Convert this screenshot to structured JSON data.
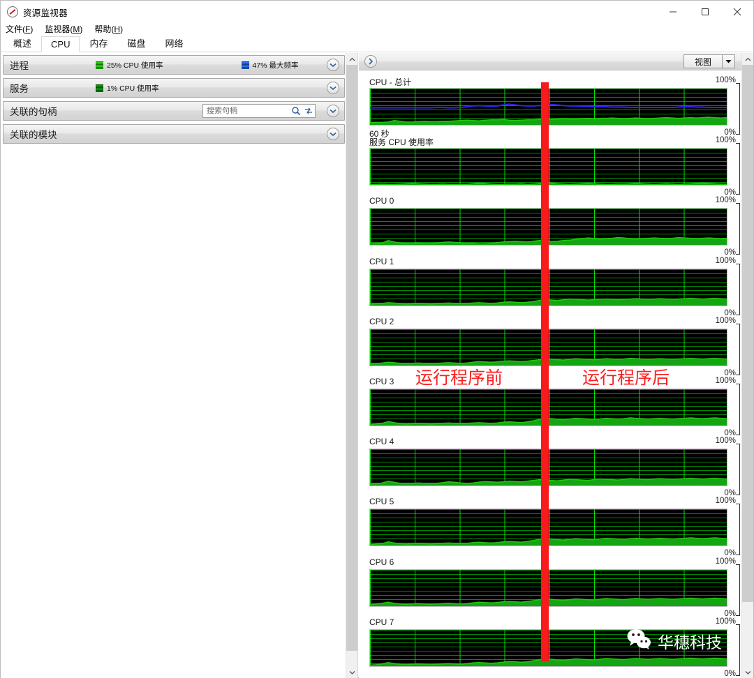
{
  "window": {
    "title": "资源监视器",
    "icon": "gauge-icon",
    "controls": {
      "minimize": "—",
      "maximize": "▢",
      "close": "✕"
    }
  },
  "menu": [
    {
      "label": "文件",
      "accel": "F"
    },
    {
      "label": "监视器",
      "accel": "M"
    },
    {
      "label": "帮助",
      "accel": "H"
    }
  ],
  "tabs": [
    {
      "label": "概述",
      "active": false
    },
    {
      "label": "CPU",
      "active": true
    },
    {
      "label": "内存",
      "active": false
    },
    {
      "label": "磁盘",
      "active": false
    },
    {
      "label": "网络",
      "active": false
    }
  ],
  "left_panels": [
    {
      "title": "进程",
      "stats": [
        {
          "color": "#35d21a",
          "label": "25% CPU 使用率"
        },
        {
          "color": "#2f6ff0",
          "label": "47% 最大频率"
        }
      ],
      "has_search": false
    },
    {
      "title": "服务",
      "stats": [
        {
          "color": "#0f9a0f",
          "label": "1% CPU 使用率"
        }
      ],
      "has_search": false
    },
    {
      "title": "关联的句柄",
      "stats": [],
      "has_search": true,
      "search_placeholder": "搜索句柄",
      "search_value": ""
    },
    {
      "title": "关联的模块",
      "stats": [],
      "has_search": false
    }
  ],
  "right_toolbar": {
    "expand_icon": "chevron-right-icon",
    "view_button": "视图",
    "view_arrow": "▼"
  },
  "annotations": {
    "before": "运行程序前",
    "after": "运行程序后",
    "line_color": "#f81b1b"
  },
  "watermark": {
    "icon": "wechat-icon",
    "text": "华穗科技"
  },
  "chart_data": [
    {
      "type": "area",
      "title": "CPU - 总计",
      "ylim": [
        0,
        100
      ],
      "ytop_label": "100%",
      "ybottom_label": "0%",
      "xlabel": "60 秒",
      "grid": true,
      "series": [
        {
          "name": "CPU 使用率",
          "color": "#22c60f",
          "values": [
            6,
            7,
            7,
            8,
            12,
            10,
            8,
            8,
            9,
            10,
            9,
            9,
            10,
            10,
            11,
            12,
            13,
            12,
            11,
            13,
            14,
            14,
            15,
            13,
            12,
            13,
            14,
            14,
            15,
            16,
            15,
            16,
            17,
            16,
            16,
            17,
            18,
            17,
            18,
            18,
            19,
            18,
            17,
            18,
            19,
            18,
            17,
            18,
            19,
            20,
            19,
            18,
            19,
            20,
            19,
            20,
            21,
            20,
            19,
            20
          ]
        },
        {
          "name": "最大频率",
          "color": "#2a2af0",
          "values": [
            47,
            47,
            47,
            47,
            47,
            47,
            47,
            47,
            47,
            47,
            47,
            48,
            48,
            47,
            47,
            48,
            50,
            52,
            53,
            52,
            51,
            52,
            55,
            57,
            55,
            53,
            52,
            52,
            53,
            55,
            56,
            55,
            53,
            52,
            52,
            51,
            51,
            50,
            50,
            50,
            49,
            49,
            49,
            48,
            48,
            48,
            48,
            48,
            48,
            48,
            48,
            49,
            50,
            50,
            49,
            49,
            48,
            48,
            48,
            48
          ]
        }
      ]
    },
    {
      "type": "area",
      "title": "服务 CPU 使用率",
      "ylim": [
        0,
        100
      ],
      "ytop_label": "100%",
      "ybottom_label": "0%",
      "grid": true,
      "series": [
        {
          "name": "服务 CPU 使用率",
          "color": "#22c60f",
          "values": [
            1,
            1,
            2,
            1,
            1,
            2,
            3,
            4,
            3,
            2,
            1,
            1,
            2,
            1,
            1,
            1,
            1,
            3,
            5,
            4,
            2,
            1,
            1,
            2,
            2,
            3,
            1,
            2,
            4,
            6,
            5,
            3,
            2,
            1,
            2,
            3,
            4,
            3,
            2,
            1,
            1,
            2,
            2,
            3,
            4,
            3,
            2,
            1,
            2,
            3,
            2,
            1,
            2,
            3,
            4,
            5,
            4,
            3,
            2,
            2
          ]
        }
      ]
    },
    {
      "type": "area",
      "title": "CPU 0",
      "ylim": [
        0,
        100
      ],
      "ytop_label": "100%",
      "ybottom_label": "0%",
      "grid": true,
      "series": [
        {
          "name": "CPU 0",
          "color": "#22c60f",
          "values": [
            3,
            4,
            5,
            12,
            8,
            5,
            4,
            4,
            5,
            4,
            4,
            5,
            7,
            8,
            7,
            5,
            4,
            4,
            3,
            3,
            4,
            6,
            8,
            9,
            10,
            9,
            8,
            10,
            12,
            11,
            9,
            10,
            12,
            13,
            15,
            17,
            19,
            18,
            16,
            17,
            18,
            20,
            19,
            17,
            16,
            17,
            18,
            19,
            18,
            17,
            18,
            20,
            19,
            18,
            17,
            18,
            19,
            18,
            17,
            18
          ]
        }
      ]
    },
    {
      "type": "area",
      "title": "CPU 1",
      "ylim": [
        0,
        100
      ],
      "ytop_label": "100%",
      "ybottom_label": "0%",
      "grid": true,
      "series": [
        {
          "name": "CPU 1",
          "color": "#22c60f",
          "values": [
            4,
            5,
            6,
            8,
            7,
            5,
            4,
            5,
            6,
            5,
            4,
            5,
            6,
            7,
            6,
            5,
            6,
            7,
            8,
            7,
            6,
            7,
            9,
            10,
            9,
            8,
            9,
            11,
            14,
            16,
            15,
            14,
            16,
            18,
            17,
            16,
            15,
            16,
            17,
            18,
            17,
            16,
            17,
            18,
            19,
            18,
            17,
            18,
            19,
            18,
            17,
            18,
            19,
            20,
            19,
            18,
            19,
            20,
            19,
            18
          ]
        }
      ]
    },
    {
      "type": "area",
      "title": "CPU 2",
      "ylim": [
        0,
        100
      ],
      "ytop_label": "100%",
      "ybottom_label": "0%",
      "grid": true,
      "series": [
        {
          "name": "CPU 2",
          "color": "#22c60f",
          "values": [
            4,
            5,
            7,
            9,
            8,
            6,
            5,
            6,
            7,
            6,
            5,
            6,
            7,
            8,
            7,
            6,
            7,
            9,
            11,
            10,
            9,
            10,
            12,
            13,
            12,
            11,
            12,
            14,
            16,
            18,
            17,
            16,
            15,
            17,
            19,
            18,
            17,
            16,
            17,
            19,
            18,
            17,
            18,
            20,
            19,
            18,
            17,
            18,
            19,
            18,
            17,
            18,
            19,
            20,
            19,
            18,
            19,
            20,
            19,
            18
          ]
        }
      ]
    },
    {
      "type": "area",
      "title": "CPU 3",
      "ylim": [
        0,
        100
      ],
      "ytop_label": "100%",
      "ybottom_label": "0%",
      "grid": true,
      "series": [
        {
          "name": "CPU 3",
          "color": "#22c60f",
          "values": [
            3,
            4,
            6,
            11,
            8,
            5,
            4,
            5,
            6,
            5,
            4,
            5,
            6,
            7,
            6,
            5,
            6,
            7,
            8,
            7,
            6,
            7,
            9,
            10,
            9,
            8,
            10,
            13,
            17,
            20,
            19,
            17,
            16,
            18,
            20,
            19,
            18,
            17,
            18,
            20,
            19,
            18,
            19,
            21,
            20,
            19,
            18,
            19,
            20,
            19,
            18,
            19,
            20,
            21,
            20,
            19,
            20,
            21,
            20,
            19
          ]
        }
      ]
    },
    {
      "type": "area",
      "title": "CPU 4",
      "ylim": [
        0,
        100
      ],
      "ytop_label": "100%",
      "ybottom_label": "0%",
      "grid": true,
      "series": [
        {
          "name": "CPU 4",
          "color": "#22c60f",
          "values": [
            4,
            5,
            7,
            12,
            9,
            6,
            5,
            6,
            7,
            6,
            5,
            6,
            8,
            10,
            9,
            7,
            6,
            7,
            9,
            11,
            10,
            9,
            10,
            12,
            11,
            10,
            12,
            14,
            16,
            15,
            14,
            13,
            15,
            17,
            16,
            15,
            14,
            16,
            18,
            17,
            16,
            15,
            17,
            19,
            18,
            17,
            16,
            18,
            19,
            18,
            17,
            18,
            19,
            20,
            19,
            18,
            19,
            20,
            19,
            18
          ]
        }
      ]
    },
    {
      "type": "area",
      "title": "CPU 5",
      "ylim": [
        0,
        100
      ],
      "ytop_label": "100%",
      "ybottom_label": "0%",
      "grid": true,
      "series": [
        {
          "name": "CPU 5",
          "color": "#22c60f",
          "values": [
            3,
            4,
            5,
            10,
            7,
            5,
            4,
            5,
            6,
            5,
            4,
            5,
            6,
            7,
            6,
            5,
            6,
            8,
            9,
            8,
            7,
            8,
            10,
            11,
            10,
            9,
            11,
            14,
            17,
            19,
            18,
            16,
            15,
            17,
            19,
            18,
            17,
            16,
            18,
            20,
            19,
            18,
            17,
            19,
            20,
            19,
            18,
            19,
            20,
            19,
            18,
            19,
            20,
            21,
            20,
            19,
            20,
            21,
            20,
            19
          ]
        }
      ]
    },
    {
      "type": "area",
      "title": "CPU 6",
      "ylim": [
        0,
        100
      ],
      "ytop_label": "100%",
      "ybottom_label": "0%",
      "grid": true,
      "series": [
        {
          "name": "CPU 6",
          "color": "#22c60f",
          "values": [
            4,
            6,
            8,
            11,
            8,
            6,
            5,
            6,
            7,
            6,
            5,
            6,
            7,
            8,
            7,
            6,
            7,
            9,
            11,
            10,
            9,
            10,
            12,
            13,
            12,
            11,
            13,
            15,
            18,
            20,
            19,
            17,
            16,
            18,
            20,
            19,
            18,
            17,
            19,
            21,
            20,
            19,
            18,
            20,
            21,
            20,
            19,
            20,
            21,
            20,
            19,
            20,
            21,
            22,
            21,
            20,
            21,
            22,
            21,
            20
          ]
        }
      ]
    },
    {
      "type": "area",
      "title": "CPU 7",
      "ylim": [
        0,
        100
      ],
      "ytop_label": "100%",
      "ybottom_label": "0%",
      "grid": true,
      "series": [
        {
          "name": "CPU 7",
          "color": "#22c60f",
          "values": [
            3,
            4,
            6,
            10,
            7,
            5,
            4,
            5,
            6,
            5,
            4,
            5,
            6,
            7,
            6,
            5,
            7,
            9,
            10,
            9,
            8,
            9,
            11,
            13,
            12,
            11,
            12,
            15,
            18,
            20,
            19,
            17,
            16,
            18,
            20,
            19,
            18,
            17,
            19,
            21,
            20,
            19,
            18,
            20,
            21,
            20,
            19,
            20,
            21,
            20,
            19,
            20,
            21,
            22,
            21,
            20,
            21,
            22,
            21,
            20
          ]
        }
      ]
    }
  ]
}
